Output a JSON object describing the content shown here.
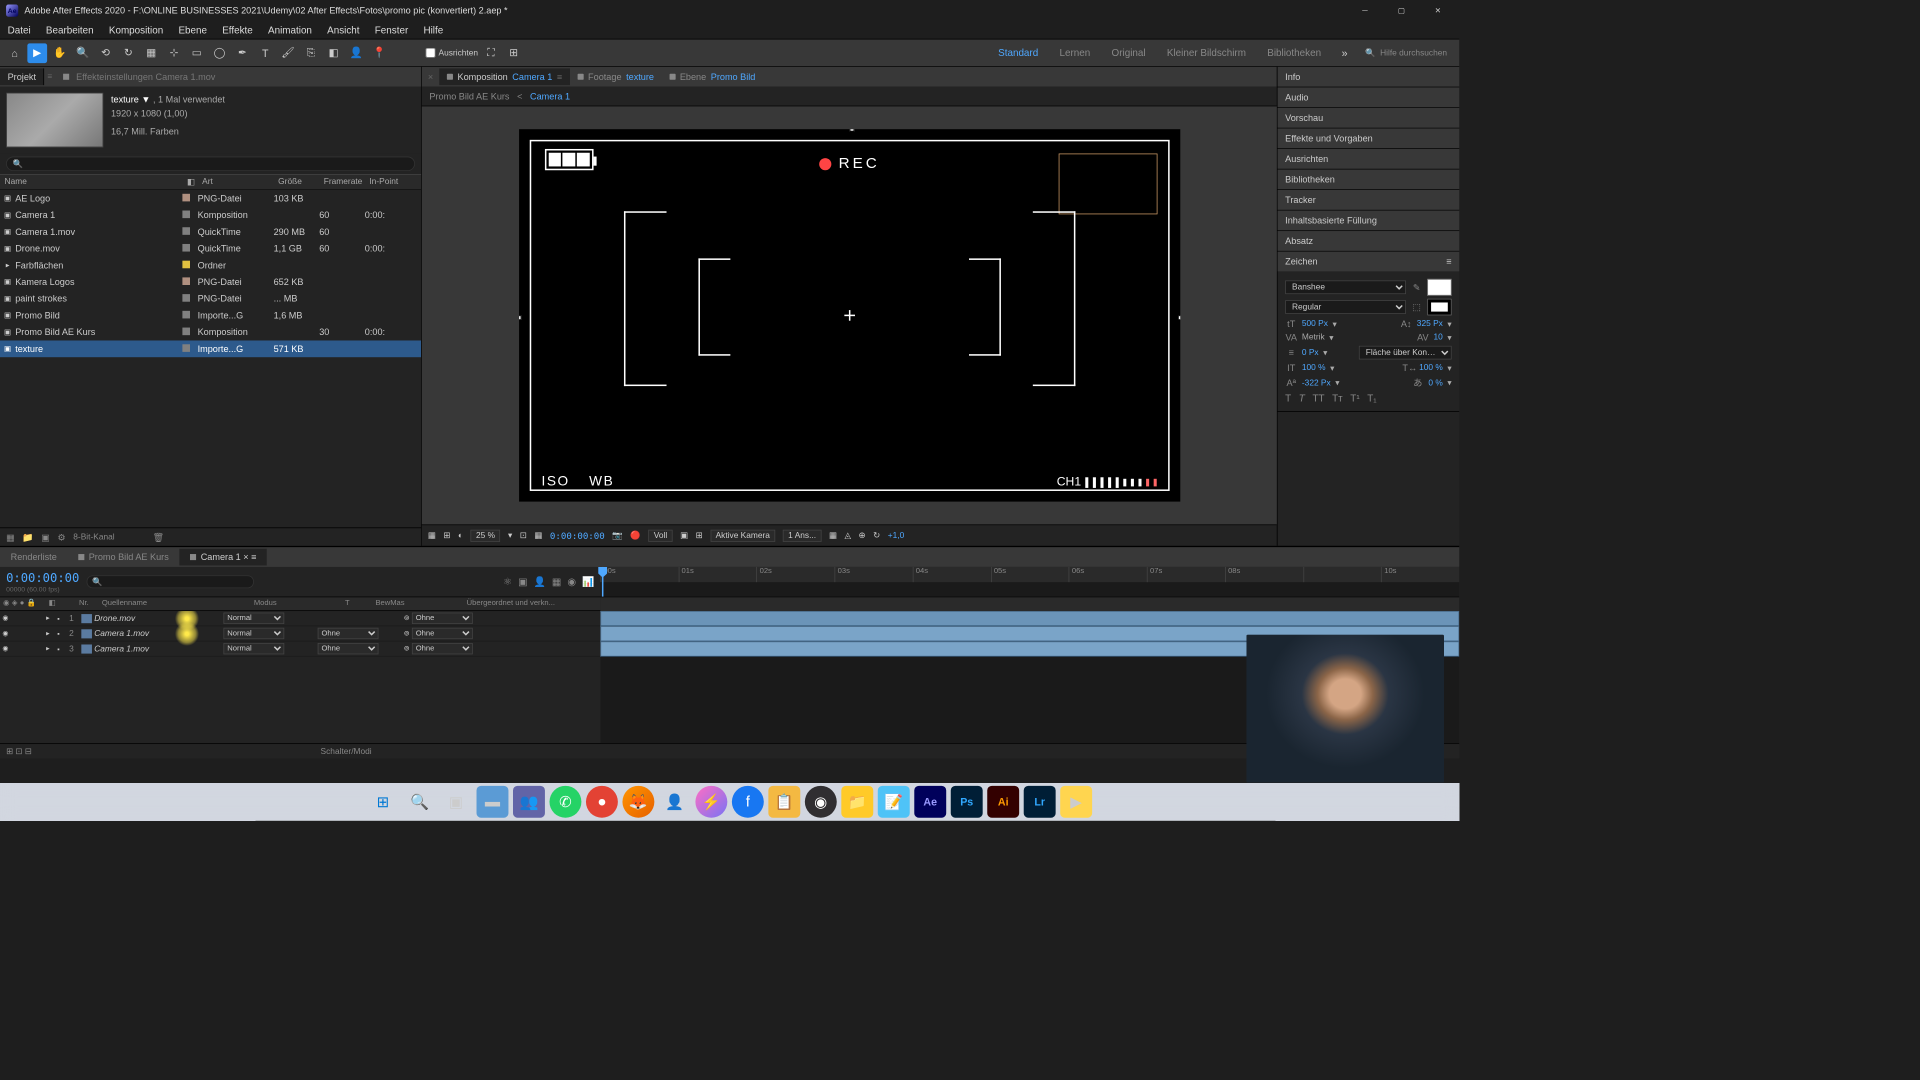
{
  "title": "Adobe After Effects 2020 - F:\\ONLINE BUSINESSES 2021\\Udemy\\02 After Effects\\Fotos\\promo pic (konvertiert) 2.aep *",
  "menu": [
    "Datei",
    "Bearbeiten",
    "Komposition",
    "Ebene",
    "Effekte",
    "Animation",
    "Ansicht",
    "Fenster",
    "Hilfe"
  ],
  "toolbar": {
    "ausrichten": "Ausrichten",
    "workspaces": [
      "Standard",
      "Lernen",
      "Original",
      "Kleiner Bildschirm",
      "Bibliotheken"
    ],
    "search_ph": "Hilfe durchsuchen"
  },
  "project": {
    "tab": "Projekt",
    "effects_tab": "Effekteinstellungen Camera 1.mov",
    "sel_name": "texture ▼",
    "sel_used": ", 1 Mal verwendet",
    "sel_dims": "1920 x 1080 (1,00)",
    "sel_colors": "16,7 Mill. Farben",
    "cols": {
      "name": "Name",
      "art": "Art",
      "size": "Größe",
      "fr": "Framerate",
      "in": "In-Point"
    },
    "items": [
      {
        "ic": "▣",
        "name": "AE Logo",
        "sw": "#b09080",
        "art": "PNG-Datei",
        "size": "103 KB",
        "fr": "",
        "in": ""
      },
      {
        "ic": "▣",
        "name": "Camera 1",
        "sw": "#808080",
        "art": "Komposition",
        "size": "",
        "fr": "60",
        "in": "0:00:"
      },
      {
        "ic": "▣",
        "name": "Camera 1.mov",
        "sw": "#808080",
        "art": "QuickTime",
        "size": "290 MB",
        "fr": "60",
        "in": ""
      },
      {
        "ic": "▣",
        "name": "Drone.mov",
        "sw": "#808080",
        "art": "QuickTime",
        "size": "1,1 GB",
        "fr": "60",
        "in": "0:00:"
      },
      {
        "ic": "▸",
        "name": "Farbflächen",
        "sw": "#e0c040",
        "art": "Ordner",
        "size": "",
        "fr": "",
        "in": ""
      },
      {
        "ic": "▣",
        "name": "Kamera Logos",
        "sw": "#b09080",
        "art": "PNG-Datei",
        "size": "652 KB",
        "fr": "",
        "in": ""
      },
      {
        "ic": "▣",
        "name": "paint strokes",
        "sw": "#808080",
        "art": "PNG-Datei",
        "size": "... MB",
        "fr": "",
        "in": ""
      },
      {
        "ic": "▣",
        "name": "Promo Bild",
        "sw": "#808080",
        "art": "Importe...G",
        "size": "1,6 MB",
        "fr": "",
        "in": ""
      },
      {
        "ic": "▣",
        "name": "Promo Bild AE Kurs",
        "sw": "#808080",
        "art": "Komposition",
        "size": "",
        "fr": "30",
        "in": "0:00:"
      },
      {
        "ic": "▣",
        "name": "texture",
        "sw": "#808080",
        "art": "Importe...G",
        "size": "571 KB",
        "fr": "",
        "in": "",
        "sel": true
      }
    ],
    "bit": "8-Bit-Kanal"
  },
  "comp": {
    "tabs": [
      {
        "label": "Komposition",
        "name": "Camera 1",
        "active": true
      },
      {
        "label": "Footage",
        "name": "texture"
      },
      {
        "label": "Ebene",
        "name": "Promo Bild"
      }
    ],
    "bc1": "Promo Bild AE Kurs",
    "bc2": "Camera 1",
    "hud": {
      "rec": "REC",
      "iso": "ISO",
      "wb": "WB",
      "ch1": "CH1"
    },
    "footer": {
      "zoom": "25 %",
      "tc": "0:00:00:00",
      "res": "Voll",
      "cam": "Aktive Kamera",
      "views": "1 Ans...",
      "exp": "+1,0"
    }
  },
  "right": {
    "panels": [
      "Info",
      "Audio",
      "Vorschau",
      "Effekte und Vorgaben",
      "Ausrichten",
      "Bibliotheken",
      "Tracker",
      "Inhaltsbasierte Füllung",
      "Absatz"
    ],
    "char": {
      "title": "Zeichen",
      "font": "Banshee",
      "weight": "Regular",
      "size": "500 Px",
      "lead": "325 Px",
      "kern": "Metrik",
      "track": "10",
      "stroke": "0 Px",
      "stroketype": "Fläche über Kon…",
      "vscale": "100 %",
      "hscale": "100 %",
      "baseline": "-322 Px",
      "tsume": "0 %"
    }
  },
  "timeline": {
    "tabs": [
      {
        "label": "Renderliste"
      },
      {
        "label": "Promo Bild AE Kurs"
      },
      {
        "label": "Camera 1",
        "active": true
      }
    ],
    "tc": "0:00:00:00",
    "sub": "00000 (60.00 fps)",
    "cols": {
      "nr": "Nr.",
      "src": "Quellenname",
      "md": "Modus",
      "t": "T",
      "bw": "BewMas",
      "par": "Übergeordnet und verkn..."
    },
    "ruler": [
      "00s",
      "01s",
      "02s",
      "03s",
      "04s",
      "05s",
      "06s",
      "07s",
      "08s",
      "",
      "10s"
    ],
    "layers": [
      {
        "nr": "1",
        "name": "Drone.mov",
        "mode": "Normal",
        "bw": "",
        "par": "Ohne",
        "hl": true
      },
      {
        "nr": "2",
        "name": "Camera 1.mov",
        "mode": "Normal",
        "bw": "Ohne",
        "par": "Ohne",
        "hl": true
      },
      {
        "nr": "3",
        "name": "Camera 1.mov",
        "mode": "Normal",
        "bw": "Ohne",
        "par": "Ohne"
      }
    ],
    "foot": "Schalter/Modi"
  }
}
